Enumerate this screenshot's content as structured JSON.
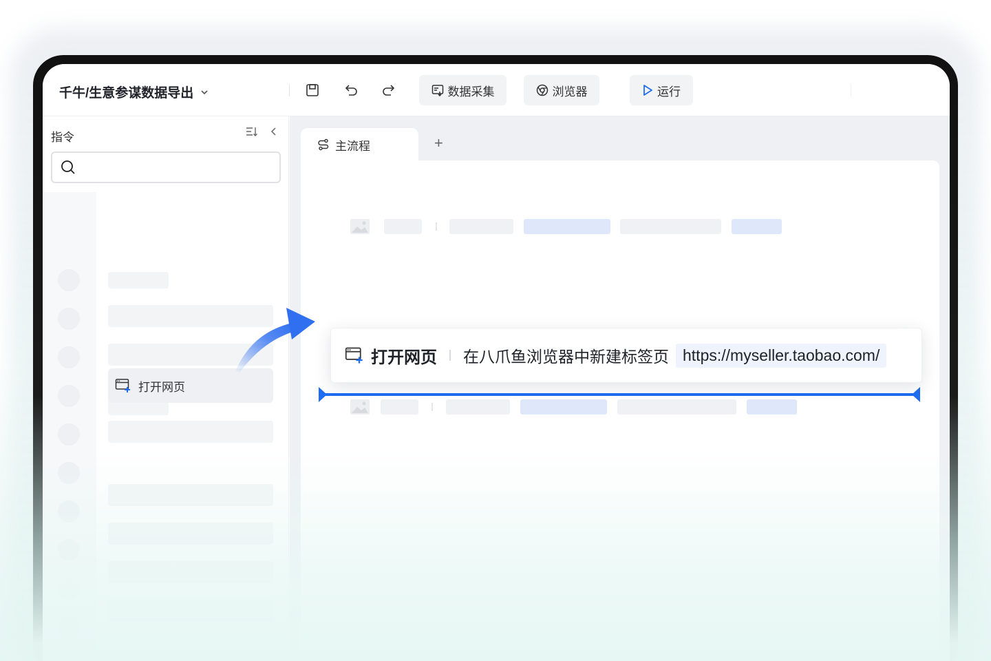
{
  "toolbar": {
    "project_title": "千牛/生意参谋数据导出",
    "dropdown_icon": "chevron-down-icon",
    "save_icon": "save-icon",
    "undo_icon": "undo-icon",
    "redo_icon": "redo-icon",
    "data_collect_label": "数据采集",
    "browser_label": "浏览器",
    "run_label": "运行"
  },
  "sidebar": {
    "title": "指令",
    "search_placeholder": "",
    "highlighted_command": "打开网页"
  },
  "tabs": [
    {
      "label": "主流程",
      "icon": "flow-icon"
    }
  ],
  "add_tab_symbol": "+",
  "step_card": {
    "label": "打开网页",
    "description": "在八爪鱼浏览器中新建标签页",
    "url": "https://myseller.taobao.com/"
  },
  "colors": {
    "accent": "#1f6df2",
    "placeholder_gray": "#eff1f4",
    "placeholder_blue": "#dfe8fb"
  }
}
